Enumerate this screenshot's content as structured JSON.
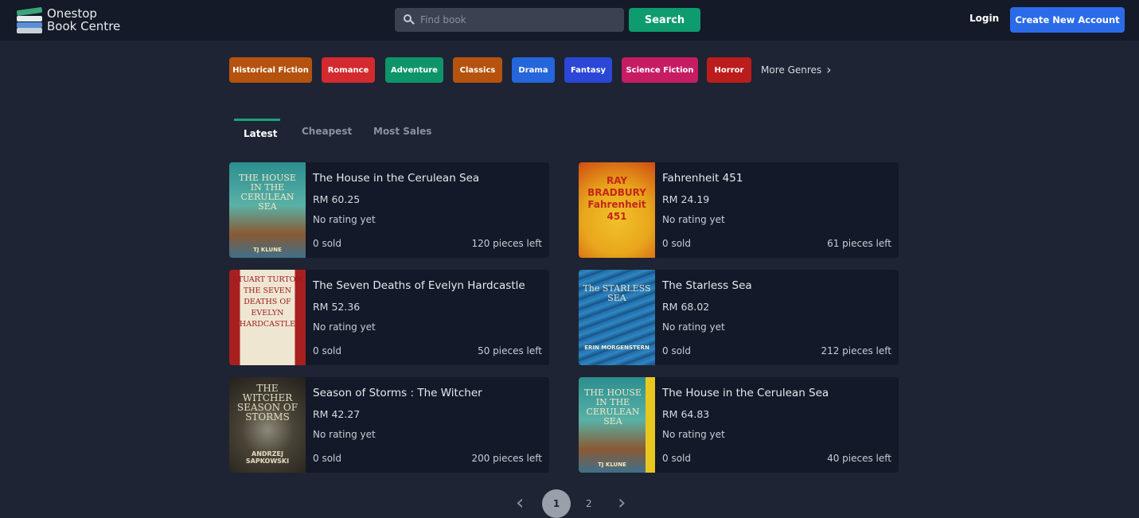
{
  "header": {
    "logo_line1": "Onestop",
    "logo_line2": "Book Centre",
    "search_placeholder": "Find book",
    "search_button": "Search",
    "login": "Login",
    "create_account": "Create New Account"
  },
  "genres": [
    {
      "label": "Historical Fiction",
      "color": "#b5530e"
    },
    {
      "label": "Romance",
      "color": "#d42a2f"
    },
    {
      "label": "Adventure",
      "color": "#0d9569"
    },
    {
      "label": "Classics",
      "color": "#b5530e"
    },
    {
      "label": "Drama",
      "color": "#2566dc"
    },
    {
      "label": "Fantasy",
      "color": "#2b47d6"
    },
    {
      "label": "Science Fiction",
      "color": "#c61d62"
    },
    {
      "label": "Horror",
      "color": "#bb1c1c"
    }
  ],
  "more_genres": "More Genres",
  "tabs": [
    {
      "label": "Latest",
      "active": true
    },
    {
      "label": "Cheapest",
      "active": false
    },
    {
      "label": "Most Sales",
      "active": false
    }
  ],
  "books": [
    {
      "title": "The House in the Cerulean Sea",
      "price": "RM 60.25",
      "rating": "No rating yet",
      "sold": "0 sold",
      "left": "120 pieces left",
      "cover_title": "THE HOUSE IN THE CERULEAN SEA",
      "cover_author": "TJ KLUNE"
    },
    {
      "title": "Fahrenheit 451",
      "price": "RM 24.19",
      "rating": "No rating yet",
      "sold": "0 sold",
      "left": "61 pieces left",
      "cover_title": "RAY BRADBURY Fahrenheit 451",
      "cover_author": ""
    },
    {
      "title": "The Seven Deaths of Evelyn Hardcastle",
      "price": "RM 52.36",
      "rating": "No rating yet",
      "sold": "0 sold",
      "left": "50 pieces left",
      "cover_title": "STUART TURTON THE SEVEN DEATHS OF EVELYN HARDCASTLE",
      "cover_author": ""
    },
    {
      "title": "The Starless Sea",
      "price": "RM 68.02",
      "rating": "No rating yet",
      "sold": "0 sold",
      "left": "212 pieces left",
      "cover_title": "The STARLESS SEA",
      "cover_author": "ERIN MORGENSTERN"
    },
    {
      "title": "Season of Storms : The Witcher",
      "price": "RM 42.27",
      "rating": "No rating yet",
      "sold": "0 sold",
      "left": "200 pieces left",
      "cover_title": "THE WITCHER SEASON OF STORMS",
      "cover_author": "ANDRZEJ SAPKOWSKI"
    },
    {
      "title": "The House in the Cerulean Sea",
      "price": "RM 64.83",
      "rating": "No rating yet",
      "sold": "0 sold",
      "left": "40 pieces left",
      "cover_title": "THE HOUSE IN THE CERULEAN SEA",
      "cover_author": "TJ KLUNE"
    }
  ],
  "pagination": {
    "current": "1",
    "next": "2",
    "prev_icon": "chevron-left-icon",
    "next_icon": "chevron-right-icon"
  }
}
